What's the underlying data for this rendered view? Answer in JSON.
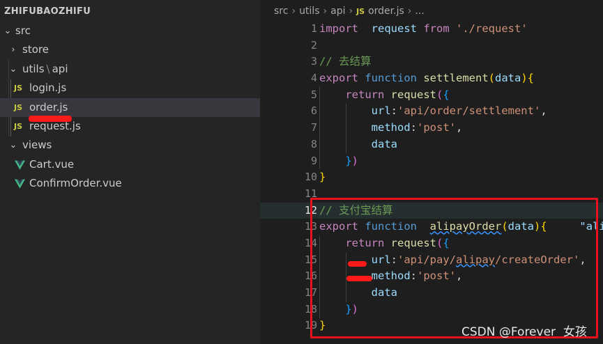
{
  "explorer": {
    "title": "ZHIFUBAOZHIFU",
    "items": [
      {
        "label": "src",
        "type": "folder",
        "expanded": true
      },
      {
        "label": "store",
        "type": "folder",
        "expanded": false
      },
      {
        "label": "utils",
        "label_b": "api",
        "type": "folder",
        "expanded": true
      },
      {
        "label": "login.js",
        "type": "js",
        "icon_text": "JS"
      },
      {
        "label": "order.js",
        "type": "js",
        "icon_text": "JS",
        "selected": true
      },
      {
        "label": "request.js",
        "type": "js",
        "icon_text": "JS"
      },
      {
        "label": "views",
        "type": "folder",
        "expanded": true
      },
      {
        "label": "Cart.vue",
        "type": "vue"
      },
      {
        "label": "ConfirmOrder.vue",
        "type": "vue"
      }
    ]
  },
  "breadcrumb": {
    "parts": [
      "src",
      "utils",
      "api"
    ],
    "file_icon": "JS",
    "file": "order.js",
    "tail": "..."
  },
  "editor": {
    "active_line": 12,
    "lines": [
      {
        "n": "1",
        "tokens": [
          [
            "kw",
            "import"
          ],
          [
            "",
            "  "
          ],
          [
            "vr",
            "request"
          ],
          [
            "",
            ""
          ],
          [
            "kw",
            " from"
          ],
          [
            "st",
            " './request'"
          ]
        ]
      },
      {
        "n": "2",
        "tokens": []
      },
      {
        "n": "3",
        "tokens": [
          [
            "cm",
            "// 去结算"
          ]
        ]
      },
      {
        "n": "4",
        "tokens": [
          [
            "kw",
            "export"
          ],
          [
            "kw2",
            " function"
          ],
          [
            "fn",
            " settlement"
          ],
          [
            "b1",
            "("
          ],
          [
            "vr",
            "data"
          ],
          [
            "b1",
            ")"
          ],
          [
            "b1",
            "{"
          ]
        ]
      },
      {
        "n": "5",
        "tokens": [
          [
            "",
            "    "
          ],
          [
            "kw",
            "return"
          ],
          [
            "fn",
            " request"
          ],
          [
            "b2",
            "("
          ],
          [
            "b3",
            "{"
          ]
        ]
      },
      {
        "n": "6",
        "tokens": [
          [
            "",
            "        "
          ],
          [
            "pr",
            "url"
          ],
          [
            "",
            ":"
          ],
          [
            "st",
            "'api/order/settlement'"
          ],
          [
            "",
            ","
          ]
        ]
      },
      {
        "n": "7",
        "tokens": [
          [
            "",
            "        "
          ],
          [
            "pr",
            "method"
          ],
          [
            "",
            ":"
          ],
          [
            "st",
            "'post'"
          ],
          [
            "",
            ","
          ]
        ]
      },
      {
        "n": "8",
        "tokens": [
          [
            "",
            "        "
          ],
          [
            "vr",
            "data"
          ]
        ]
      },
      {
        "n": "9",
        "tokens": [
          [
            "",
            "    "
          ],
          [
            "b3",
            "}"
          ],
          [
            "b2",
            ")"
          ]
        ]
      },
      {
        "n": "10",
        "tokens": [
          [
            "b1",
            "}"
          ]
        ]
      },
      {
        "n": "11",
        "tokens": []
      },
      {
        "n": "12",
        "tokens": [
          [
            "cm",
            "// 支付宝结算"
          ]
        ]
      },
      {
        "n": "13",
        "tokens": [
          [
            "kw",
            "export"
          ],
          [
            "kw2",
            " function"
          ],
          [
            "",
            "  "
          ],
          [
            "fnsq",
            "alipayOrder"
          ],
          [
            "b1",
            "("
          ],
          [
            "vr",
            "data"
          ],
          [
            "b1",
            ")"
          ],
          [
            "b1",
            "{"
          ],
          [
            "",
            "     "
          ],
          [
            "vr",
            "\"ali"
          ]
        ]
      },
      {
        "n": "14",
        "tokens": [
          [
            "",
            "    "
          ],
          [
            "kw",
            "return"
          ],
          [
            "fn",
            " request"
          ],
          [
            "b2",
            "("
          ],
          [
            "b3",
            "{"
          ]
        ]
      },
      {
        "n": "15",
        "tokens": [
          [
            "",
            "        "
          ],
          [
            "pr",
            "url"
          ],
          [
            "",
            ":"
          ],
          [
            "st",
            "'api/pay/"
          ],
          [
            "stsq",
            "alipay"
          ],
          [
            "st",
            "/createOrder'"
          ],
          [
            "",
            ","
          ]
        ]
      },
      {
        "n": "16",
        "tokens": [
          [
            "",
            "        "
          ],
          [
            "pr",
            "method"
          ],
          [
            "",
            ":"
          ],
          [
            "st",
            "'post'"
          ],
          [
            "",
            ","
          ]
        ]
      },
      {
        "n": "17",
        "tokens": [
          [
            "",
            "        "
          ],
          [
            "vr",
            "data"
          ]
        ]
      },
      {
        "n": "18",
        "tokens": [
          [
            "",
            "    "
          ],
          [
            "b3",
            "}"
          ],
          [
            "b2",
            ")"
          ]
        ]
      },
      {
        "n": "19",
        "tokens": [
          [
            "b1",
            "}"
          ]
        ]
      }
    ]
  },
  "watermark": "CSDN @Forever  女孩",
  "colors": {
    "annotation_red": "#e8121e",
    "editor_bg": "#1e1e1e",
    "sidebar_bg": "#252526"
  }
}
